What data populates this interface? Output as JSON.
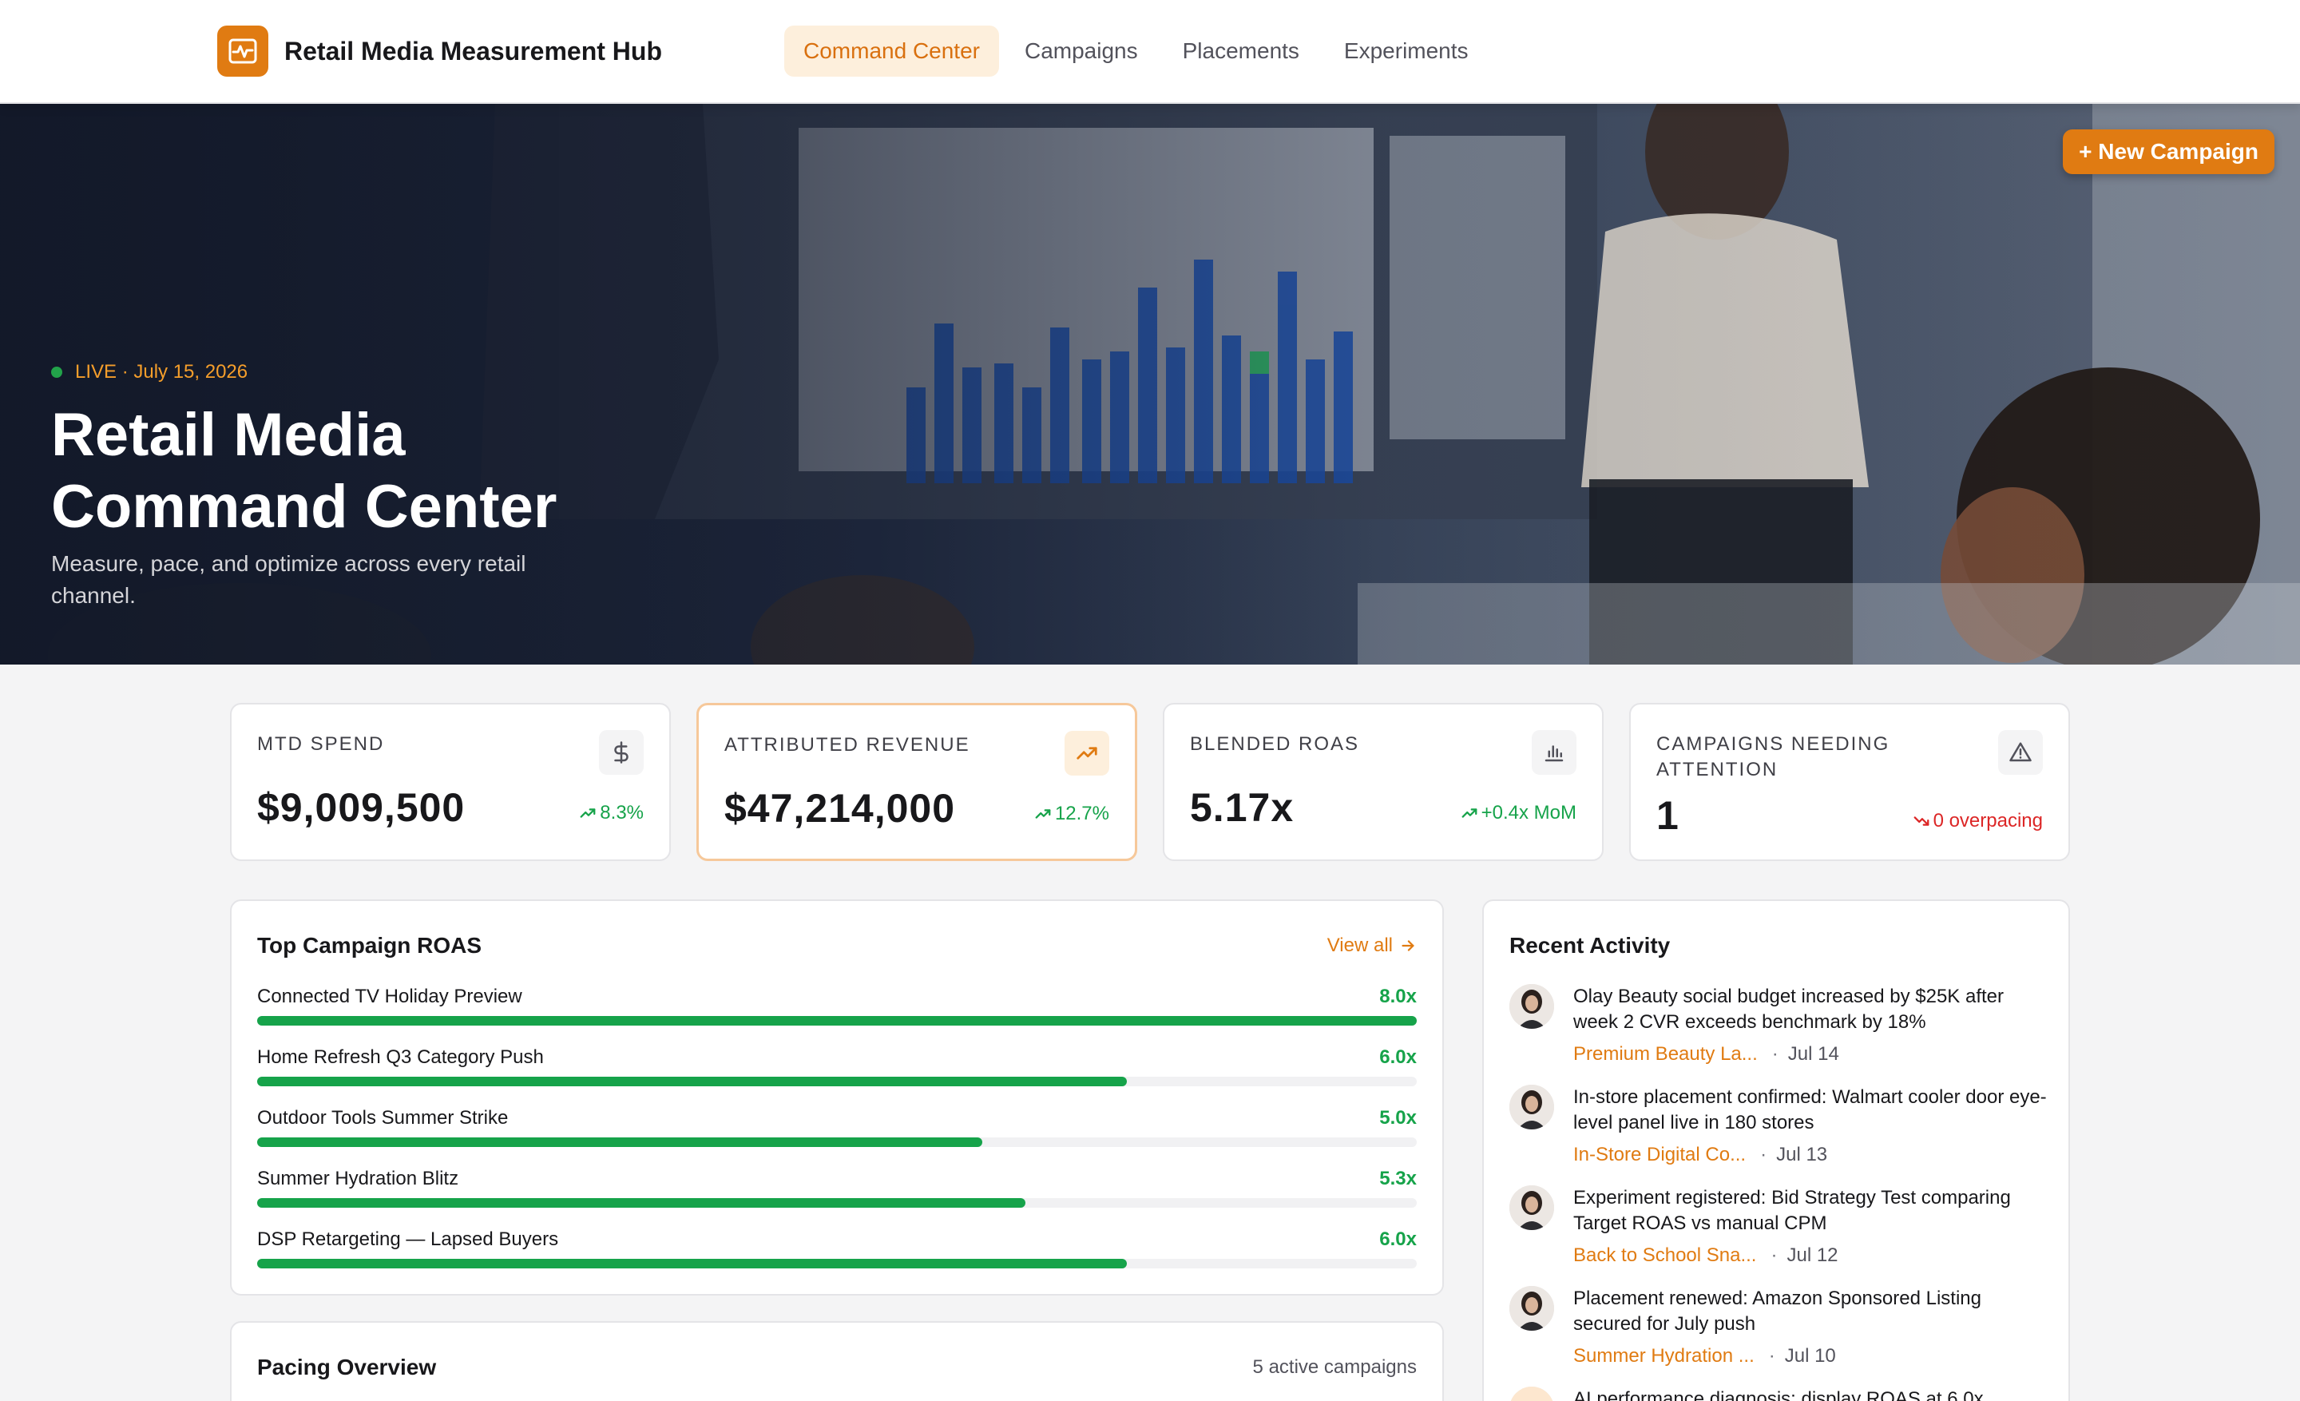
{
  "app": {
    "name": "Retail Media Measurement Hub",
    "nav": [
      {
        "label": "Command Center",
        "active": true
      },
      {
        "label": "Campaigns",
        "active": false
      },
      {
        "label": "Placements",
        "active": false
      },
      {
        "label": "Experiments",
        "active": false
      }
    ]
  },
  "hero": {
    "status": "LIVE · July 15, 2026",
    "title": "Retail Media Command Center",
    "subtitle": "Measure, pace, and optimize across every retail channel.",
    "new_campaign_label": "+ New Campaign"
  },
  "kpis": [
    {
      "label": "MTD SPEND",
      "value": "$9,009,500",
      "delta": "8.3%",
      "trend": "up",
      "icon": "dollar-icon"
    },
    {
      "label": "ATTRIBUTED REVENUE",
      "value": "$47,214,000",
      "delta": "12.7%",
      "trend": "up",
      "icon": "trending-up-icon"
    },
    {
      "label": "BLENDED ROAS",
      "value": "5.17x",
      "delta": "+0.4x MoM",
      "trend": "up",
      "icon": "bar-chart-icon"
    },
    {
      "label": "CAMPAIGNS NEEDING ATTENTION",
      "value": "1",
      "delta": "0 overpacing",
      "trend": "down",
      "icon": "warning-icon"
    }
  ],
  "top_roas": {
    "title": "Top Campaign ROAS",
    "view_all": "View all",
    "max_roas": 8.0,
    "items": [
      {
        "name": "Connected TV Holiday Preview",
        "value": "8.0x",
        "roas": 8.0
      },
      {
        "name": "Home Refresh Q3 Category Push",
        "value": "6.0x",
        "roas": 6.0
      },
      {
        "name": "Outdoor Tools Summer Strike",
        "value": "5.0x",
        "roas": 5.0
      },
      {
        "name": "Summer Hydration Blitz",
        "value": "5.3x",
        "roas": 5.3
      },
      {
        "name": "DSP Retargeting — Lapsed Buyers",
        "value": "6.0x",
        "roas": 6.0
      }
    ]
  },
  "pacing": {
    "title": "Pacing Overview",
    "subtitle": "5 active campaigns"
  },
  "activity": {
    "title": "Recent Activity",
    "items": [
      {
        "text": "Olay Beauty social budget increased by $25K after week 2 CVR exceeds benchmark by 18%",
        "link": "Premium Beauty La...",
        "date": "Jul 14"
      },
      {
        "text": "In-store placement confirmed: Walmart cooler door eye-level panel live in 180 stores",
        "link": "In-Store Digital Co...",
        "date": "Jul 13"
      },
      {
        "text": "Experiment registered: Bid Strategy Test comparing Target ROAS vs manual CPM",
        "link": "Back to School Sna...",
        "date": "Jul 12"
      },
      {
        "text": "Placement renewed: Amazon Sponsored Listing secured for July push",
        "link": "Summer Hydration ...",
        "date": "Jul 10"
      },
      {
        "text": "AI performance diagnosis: display ROAS at 6.0x",
        "link": "",
        "date": ""
      }
    ]
  },
  "colors": {
    "accent": "#e07b12",
    "success": "#16a34a",
    "danger": "#dc2626"
  }
}
